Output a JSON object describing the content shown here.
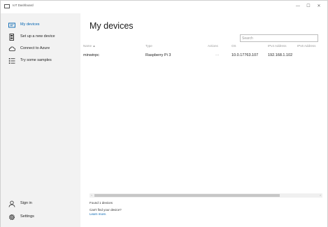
{
  "window": {
    "title": "IoT Dashboard",
    "controls": {
      "minimize": "—",
      "maximize": "☐",
      "close": "✕"
    }
  },
  "sidebar": {
    "items": [
      {
        "label": "My devices",
        "icon": "devices-icon",
        "selected": true
      },
      {
        "label": "Set up a new device",
        "icon": "new-device-icon",
        "selected": false
      },
      {
        "label": "Connect to Azure",
        "icon": "cloud-icon",
        "selected": false
      },
      {
        "label": "Try some samples",
        "icon": "list-icon",
        "selected": false
      }
    ],
    "bottom": [
      {
        "label": "Sign in",
        "icon": "person-icon"
      },
      {
        "label": "Settings",
        "icon": "gear-icon"
      }
    ]
  },
  "main": {
    "title": "My devices",
    "search": {
      "placeholder": "Search",
      "value": ""
    },
    "columns": {
      "name": "Name ▲",
      "type": "Type",
      "actions": "Actions",
      "os": "OS",
      "ipv4": "IPv4 Address",
      "ipv6": "IPv6 Address"
    },
    "rows": [
      {
        "name": "minwinpc",
        "type": "Raspberry Pi 3",
        "actions": "···",
        "os": "10.0.17763.107",
        "ipv4": "192.168.1.102",
        "ipv6": ""
      }
    ],
    "footer": {
      "found": "Found 1 devices",
      "cant_find": "Can't find your device?",
      "learn_more": "Learn more."
    }
  },
  "colors": {
    "accent": "#0063b1",
    "sidebar_bg": "#f2f2f2",
    "header_text": "#9a9a9a"
  }
}
